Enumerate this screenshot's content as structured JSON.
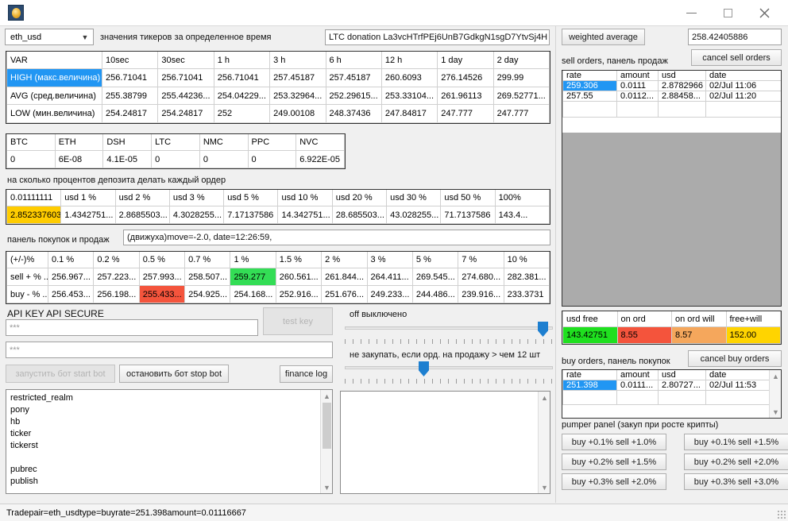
{
  "window": {
    "icon": "coin-icon",
    "title": "",
    "minimize": "–",
    "maximize": "□",
    "close": "✕"
  },
  "top": {
    "pair_selected": "eth_usd",
    "pair_caption": "значения тикеров за определенное время",
    "donation": "LTC donation  La3vcHTrfPEj6UnB7GdkgN1sgD7YtvSj4H"
  },
  "ticker_table": {
    "headers": [
      "VAR",
      "10sec",
      "30sec",
      "1 h",
      "3 h",
      "6 h",
      "12 h",
      "1 day",
      "2 day"
    ],
    "rows": [
      {
        "label": "HIGH (макс.величина)",
        "selected": true,
        "values": [
          "256.71041",
          "256.71041",
          "256.71041",
          "257.45187",
          "257.45187",
          "260.6093",
          "276.14526",
          "299.99"
        ]
      },
      {
        "label": "AVG (сред.величина)",
        "selected": false,
        "values": [
          "255.38799",
          "255.44236...",
          "254.04229...",
          "253.32964...",
          "252.29615...",
          "253.33104...",
          "261.96113",
          "269.52771..."
        ]
      },
      {
        "label": "LOW (мин.величина)",
        "selected": false,
        "values": [
          "254.24817",
          "254.24817",
          "252",
          "249.00108",
          "248.37436",
          "247.84817",
          "247.777",
          "247.777"
        ]
      }
    ]
  },
  "balance_table": {
    "headers": [
      "BTC",
      "ETH",
      "DSH",
      "LTC",
      "NMC",
      "PPC",
      "NVC"
    ],
    "values": [
      "0",
      "6E-08",
      "4.1E-05",
      "0",
      "0",
      "0",
      "6.922E-05"
    ]
  },
  "deposit": {
    "caption": "на сколько процентов депозита делать каждый ордер",
    "headers": [
      "0.01111111",
      "usd 1 %",
      "usd 2 %",
      "usd 3 %",
      "usd 5 %",
      "usd 10 %",
      "usd 20 %",
      "usd 30 %",
      "usd 50 %",
      "100%"
    ],
    "values": [
      "2.852337603...",
      "1.4342751...",
      "2.8685503...",
      "4.3028255...",
      "7.17137586",
      "14.342751...",
      "28.685503...",
      "43.028255...",
      "71.7137586",
      "143.4..."
    ],
    "highlight_color": "#ffcc00"
  },
  "trade_panel": {
    "caption": "панель покупок и продаж",
    "status": "(движуха)move=-2.0, date=12:26:59,",
    "headers": [
      "(+/-)%",
      "0.1 %",
      "0.2 %",
      "0.5 %",
      "0.7 %",
      "1 %",
      "1.5 %",
      "2 %",
      "3 %",
      "5 %",
      "7 %",
      "10 %"
    ],
    "sell_label": "sell + % ...",
    "sell_values": [
      "256.967...",
      "257.223...",
      "257.993...",
      "258.507...",
      "259.277",
      "260.561...",
      "261.844...",
      "264.411...",
      "269.545...",
      "274.680...",
      "282.381..."
    ],
    "sell_highlight_index": 4,
    "sell_highlight_color": "#33dd55",
    "buy_label": "buy - % ...",
    "buy_values": [
      "256.453...",
      "256.198...",
      "255.433...",
      "254.925...",
      "254.168...",
      "252.916...",
      "251.676...",
      "249.233...",
      "244.486...",
      "239.916...",
      "233.3731"
    ],
    "buy_highlight_index": 2,
    "buy_highlight_color": "#f4543c"
  },
  "api": {
    "caption": "API KEY  API SECURE",
    "key_value": "***",
    "secure_value": "***",
    "test_key_button": "test key",
    "start_bot_button": "запустить бот start bot",
    "stop_bot_button": "остановить бот stop bot",
    "finance_log_button": "finance log"
  },
  "sliders": {
    "top_label": "off выключено",
    "top_value_pct": 97,
    "bottom_label": "не закупать, если орд. на продажу > чем 12 шт",
    "bottom_value_pct": 38
  },
  "log_list": {
    "items": [
      "restricted_realm",
      "pony",
      "hb",
      "ticker",
      "tickerst",
      "",
      "pubrec",
      "publish"
    ]
  },
  "right": {
    "weighted_average_button": "weighted average",
    "weighted_average_value": "258.42405886",
    "cancel_sell_button": "cancel sell orders",
    "sell_caption": "sell orders, панель продаж",
    "sell_headers": [
      "rate",
      "amount",
      "usd",
      "date"
    ],
    "sell_rows": [
      {
        "rate": "259.306",
        "amount": "0.0111",
        "usd": "2.8782966",
        "date": "02/Jul 11:06",
        "selected": true
      },
      {
        "rate": "257.55",
        "amount": "0.0112...",
        "usd": "2.88458...",
        "date": "02/Jul 11:20",
        "selected": false
      }
    ],
    "funds_headers": [
      "usd free",
      "on ord",
      "on ord will",
      "free+will"
    ],
    "funds_values": [
      "143.42751",
      "8.55",
      "8.57",
      "152.00"
    ],
    "funds_colors": [
      "#1fe01f",
      "#f4543c",
      "#f5a75c",
      "#ffd400"
    ],
    "cancel_buy_button": "cancel buy orders",
    "buy_caption": "buy orders, панель покупок",
    "buy_headers": [
      "rate",
      "amount",
      "usd",
      "date"
    ],
    "buy_rows": [
      {
        "rate": "251.398",
        "amount": "0.0111...",
        "usd": "2.80727...",
        "date": "02/Jul 11:53",
        "selected": true
      }
    ],
    "pumper_caption": "pumper panel (закуп при росте крипты)",
    "pumper_buttons_left": [
      "buy +0.1% sell +1.0%",
      "buy +0.2% sell +1.5%",
      "buy +0.3% sell +2.0%"
    ],
    "pumper_buttons_right": [
      "buy +0.1% sell +1.5%",
      "buy +0.2% sell +2.0%",
      "buy +0.3% sell +3.0%"
    ]
  },
  "statusbar": {
    "text": "Tradepair=eth_usdtype=buyrate=251.398amount=0.01116667"
  },
  "overflow": {
    "clipped_button": "buy +0.3% sell +3.0%"
  }
}
